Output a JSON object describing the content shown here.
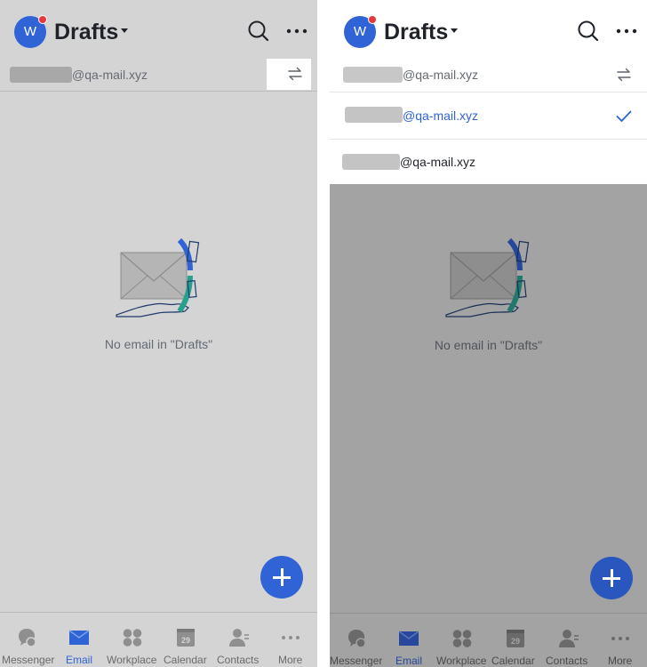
{
  "colors": {
    "accent": "#2f63d6",
    "notification_dot": "#e8383d",
    "overlay_left": "#d4d4d4",
    "overlay_right": "#a3a3a3",
    "text_primary": "#1f2329",
    "text_secondary": "#646a73"
  },
  "left": {
    "header": {
      "avatar_initial": "W",
      "title": "Drafts"
    },
    "account": {
      "email_suffix": "@qa-mail.xyz"
    },
    "empty_state": {
      "message": "No email in \"Drafts\""
    }
  },
  "right": {
    "header": {
      "avatar_initial": "W",
      "title": "Drafts"
    },
    "account": {
      "email_suffix": "@qa-mail.xyz"
    },
    "account_menu": [
      {
        "email_suffix": "@qa-mail.xyz",
        "selected": true
      },
      {
        "email_suffix": "@qa-mail.xyz",
        "selected": false
      }
    ],
    "empty_state": {
      "message": "No email in \"Drafts\""
    }
  },
  "tabs": [
    {
      "label": "Messenger",
      "icon": "messenger-icon",
      "active": false
    },
    {
      "label": "Email",
      "icon": "email-icon",
      "active": true
    },
    {
      "label": "Workplace",
      "icon": "workplace-icon",
      "active": false
    },
    {
      "label": "Calendar",
      "icon": "calendar-icon",
      "active": false,
      "badge": "29"
    },
    {
      "label": "Contacts",
      "icon": "contacts-icon",
      "active": false
    },
    {
      "label": "More",
      "icon": "more-icon",
      "active": false
    }
  ]
}
